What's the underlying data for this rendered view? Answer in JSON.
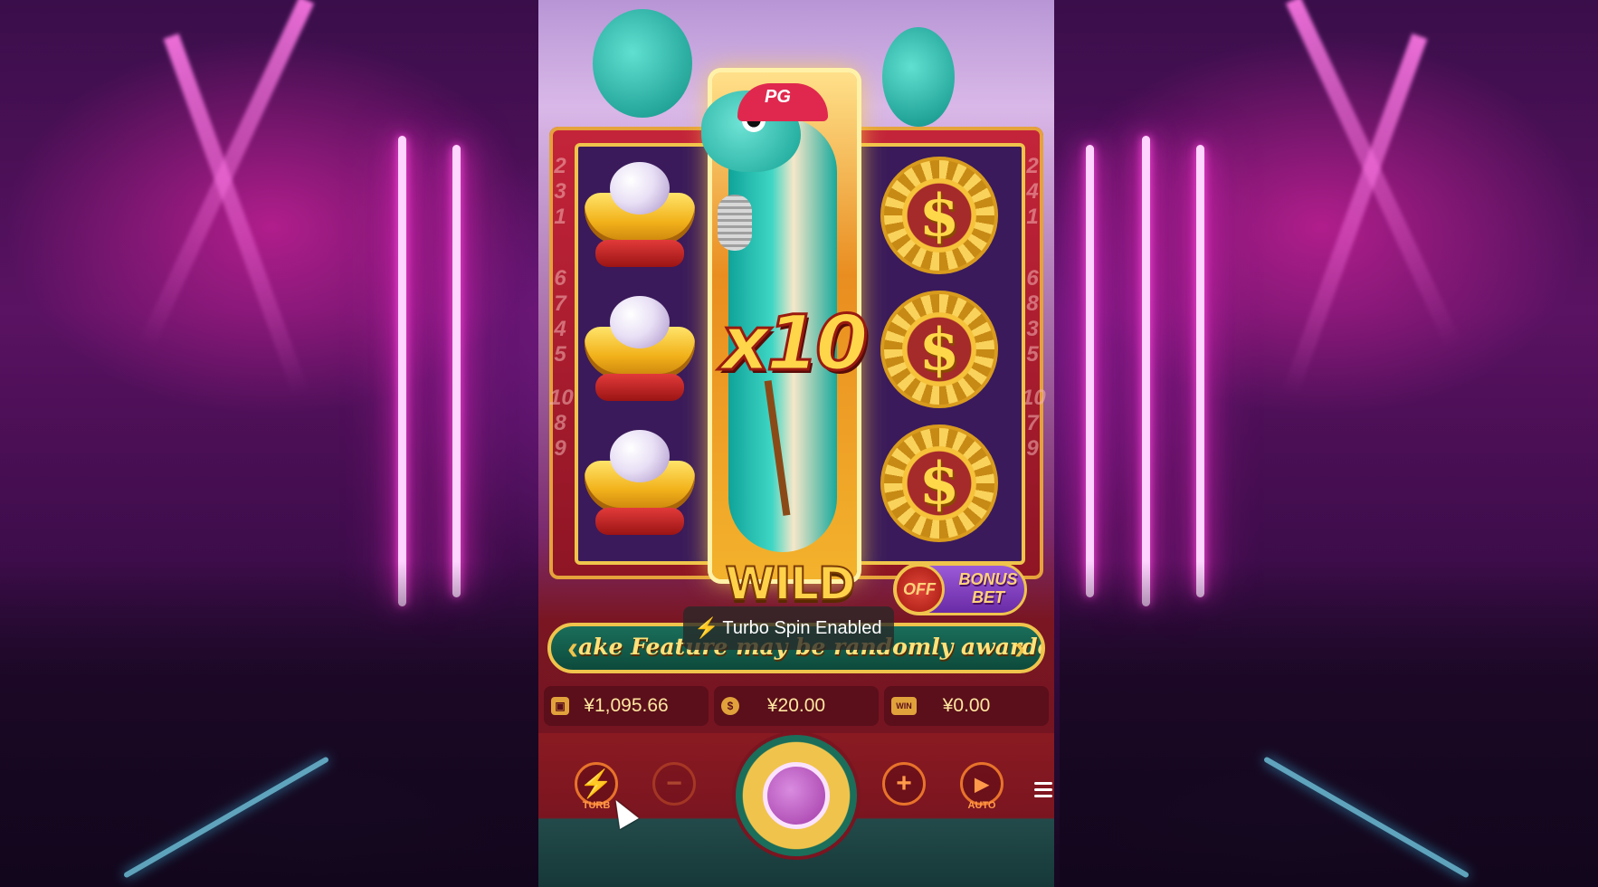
{
  "backdrop": {
    "theme": "concert-stage",
    "neon_color": "#ff4fe0"
  },
  "reels": {
    "left_numbers": [
      "2",
      "3",
      "1",
      "6",
      "7",
      "4",
      "5",
      "10",
      "8",
      "9"
    ],
    "right_numbers": [
      "2",
      "4",
      "1",
      "6",
      "8",
      "3",
      "5",
      "10",
      "7",
      "9"
    ],
    "columns": [
      {
        "symbols": [
          "gold-ingot-pearl",
          "gold-ingot-pearl",
          "gold-ingot-pearl"
        ]
      },
      {
        "symbols": [
          "snake-wild"
        ]
      },
      {
        "symbols": [
          "gold-dollar-chain",
          "gold-dollar-chain",
          "gold-dollar-chain"
        ]
      }
    ],
    "coin_symbol": "$",
    "cap_text": "PG"
  },
  "wild": {
    "multiplier": "x10",
    "label": "WILD"
  },
  "bonus_bet": {
    "state": "OFF",
    "label_line1": "BONUS",
    "label_line2": "BET"
  },
  "marquee": {
    "text": "ake Feature may be randomly awarded!"
  },
  "toast": {
    "icon": "lightning-icon",
    "text": "Turbo Spin Enabled"
  },
  "info_bar": {
    "balance": {
      "icon": "wallet-icon",
      "value": "¥1,095.66"
    },
    "bet": {
      "icon": "coin-stack-icon",
      "value": "¥20.00"
    },
    "win": {
      "icon": "win-icon",
      "icon_text": "WIN",
      "value": "¥0.00"
    }
  },
  "controls": {
    "turbo": {
      "icon": "lightning-icon",
      "label": "TURB"
    },
    "minus": {
      "icon": "minus-icon",
      "symbol": "−"
    },
    "plus": {
      "icon": "plus-icon",
      "symbol": "+"
    },
    "auto": {
      "icon": "play-icon",
      "label": "AUTO"
    },
    "spin": {
      "icon": "spin-icon"
    },
    "menu": {
      "icon": "menu-icon"
    }
  },
  "colors": {
    "accent_gold": "#f0c44c",
    "turbo_orange": "#ff8a1a",
    "panel_red": "#7a1520"
  }
}
